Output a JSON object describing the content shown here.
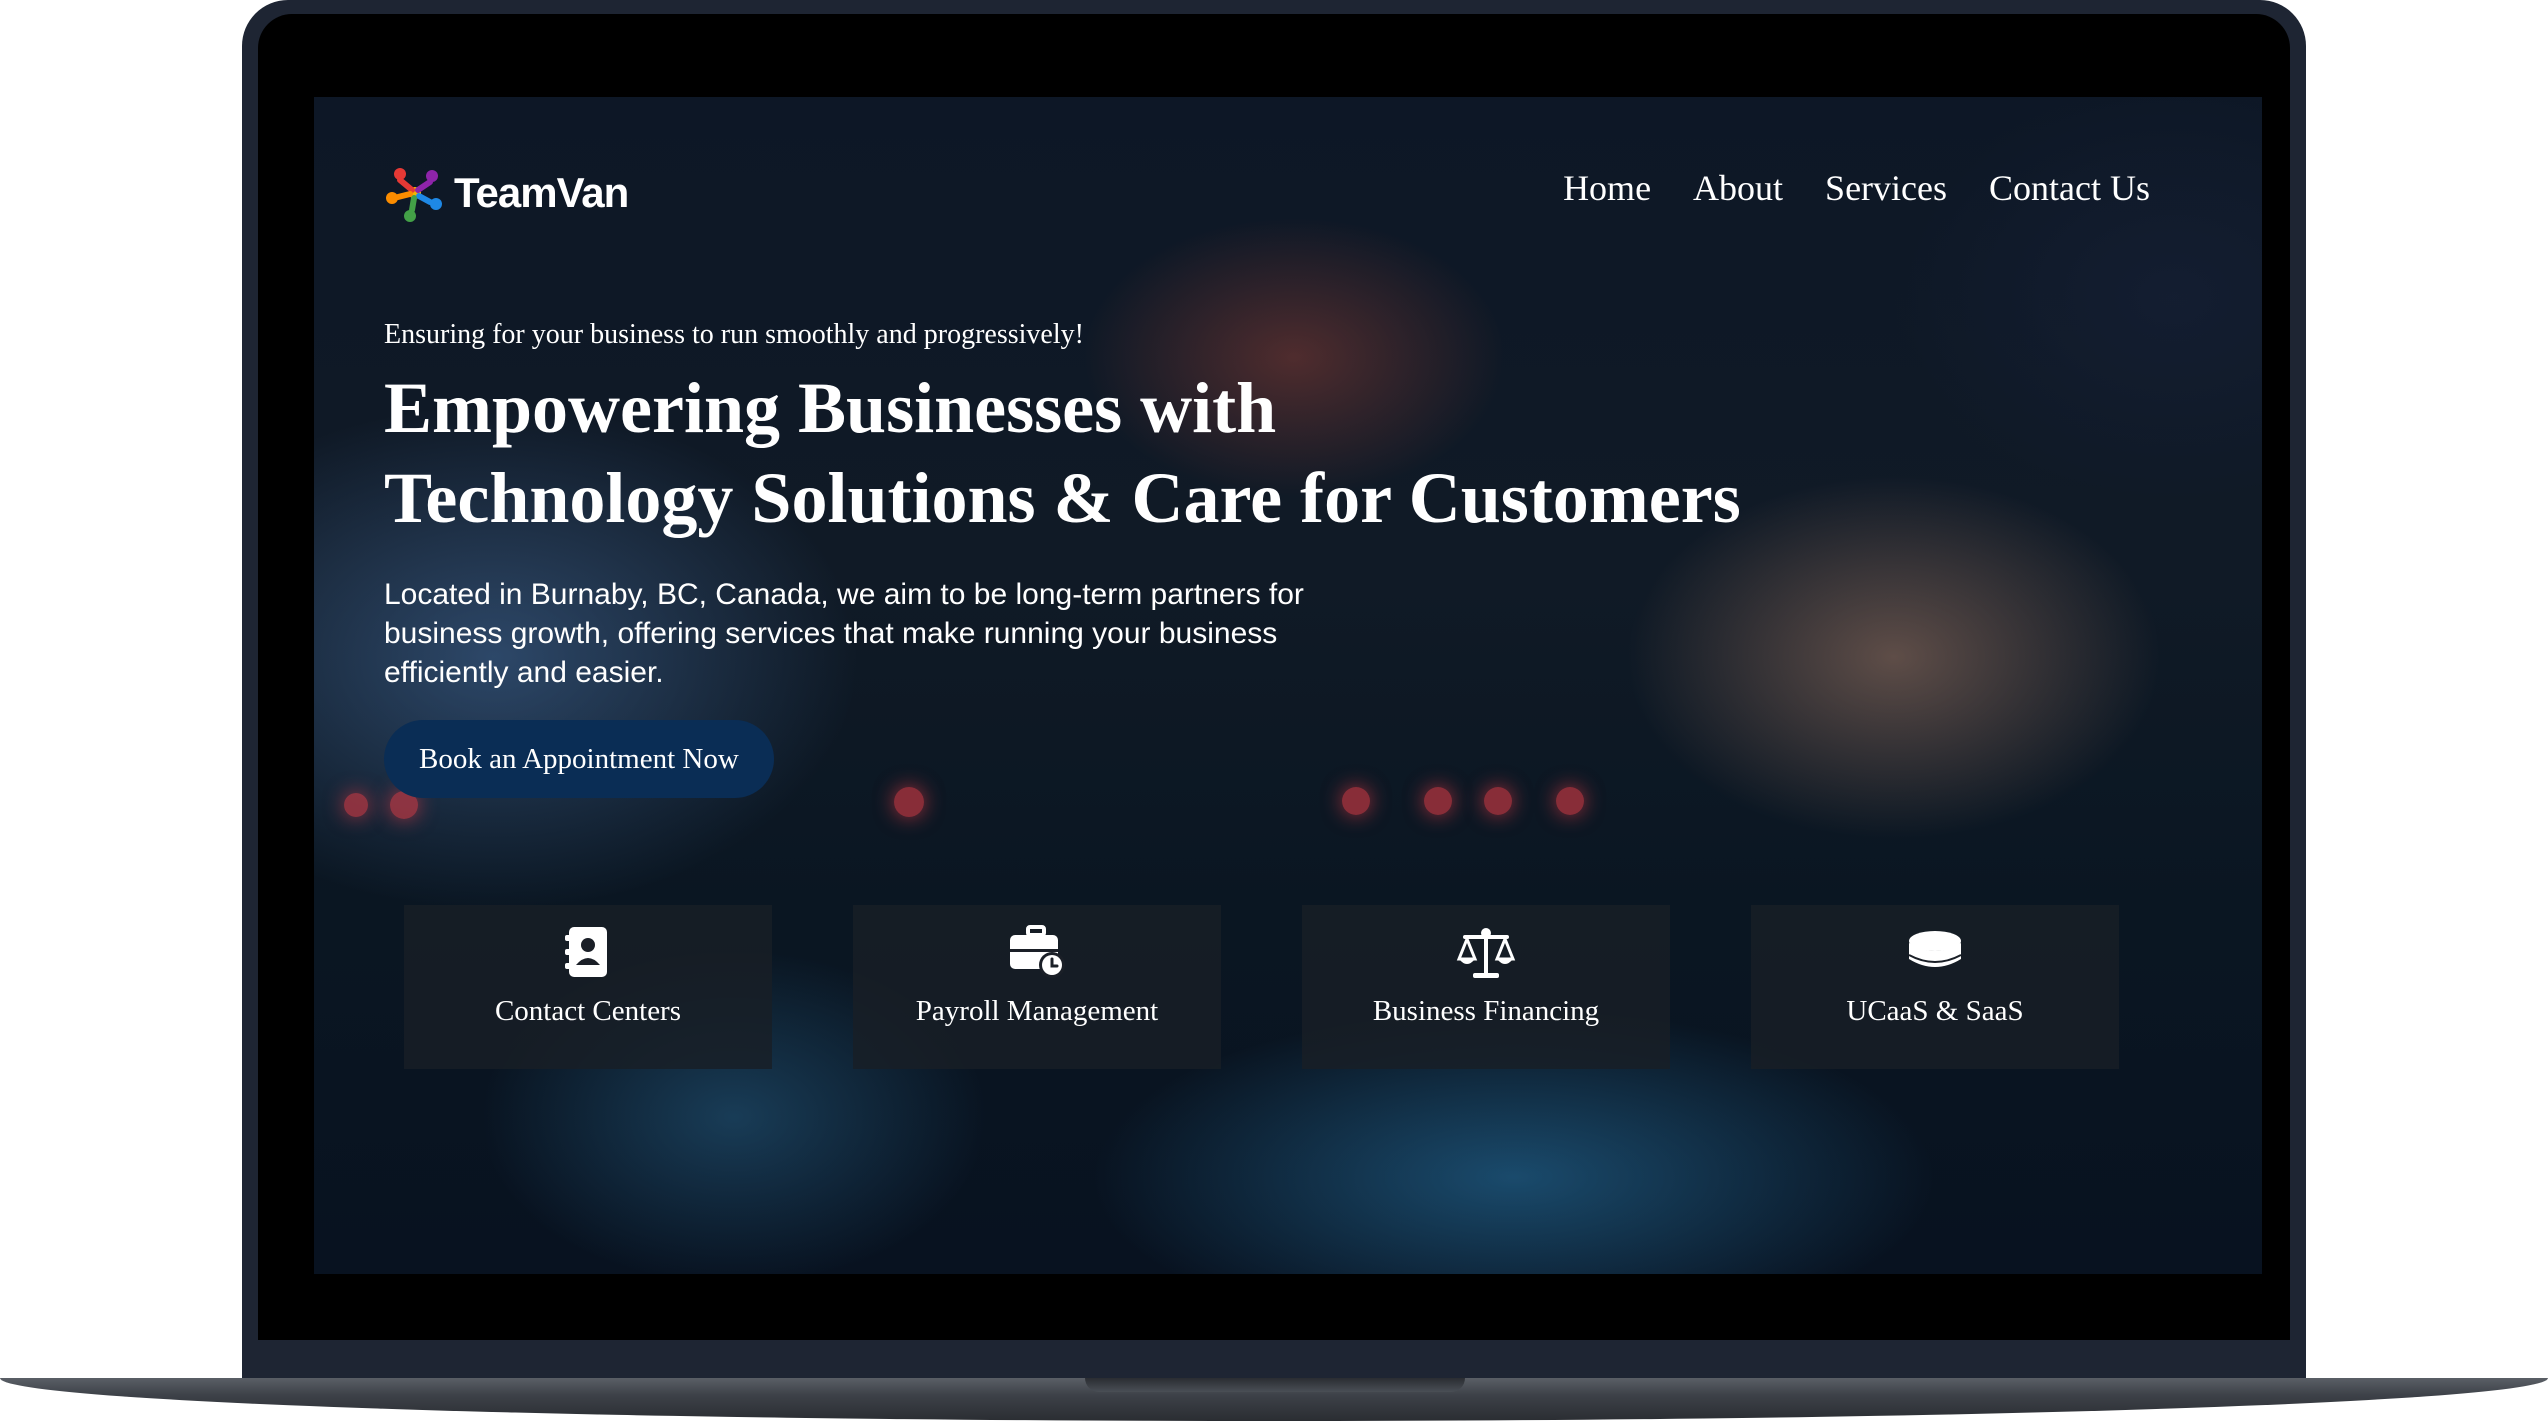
{
  "brand": {
    "name": "TeamVan",
    "logo_icon": "teamvan-people-logo"
  },
  "nav": {
    "items": [
      {
        "label": "Home"
      },
      {
        "label": "About"
      },
      {
        "label": "Services"
      },
      {
        "label": "Contact Us"
      }
    ]
  },
  "hero": {
    "tagline": "Ensuring for your business to run smoothly and progressively!",
    "headline_line1": "Empowering Businesses with",
    "headline_line2": "Technology Solutions & Care for Customers",
    "intro": "Located in Burnaby, BC, Canada, we aim to be long-term partners for business growth, offering services that make running your business efficiently and easier.",
    "cta_label": "Book an Appointment Now"
  },
  "services": [
    {
      "label": "Contact Centers",
      "icon": "address-book-icon"
    },
    {
      "label": "Payroll Management",
      "icon": "briefcase-clock-icon"
    },
    {
      "label": "Business Financing",
      "icon": "scale-balance-icon"
    },
    {
      "label": "UCaaS & SaaS",
      "icon": "database-icon"
    }
  ],
  "colors": {
    "cta_background": "#0a2d55",
    "laptop_frame": "#1e2533",
    "text": "#ffffff"
  }
}
